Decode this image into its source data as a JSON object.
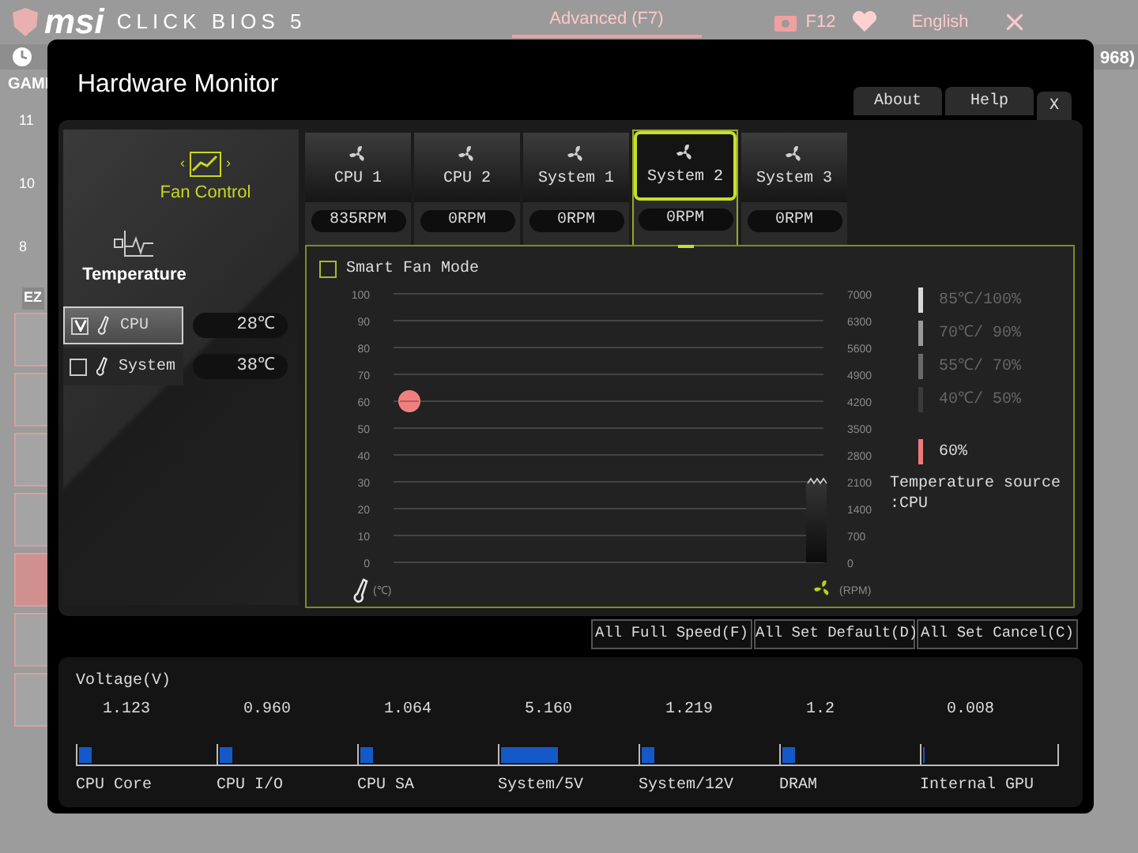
{
  "bios_header": {
    "brand": "msi",
    "product": "CLICK BIOS 5",
    "mode_tab": "Advanced (F7)",
    "screenshot_key": "F12",
    "language": "English"
  },
  "background": {
    "left_label": "GAMI",
    "right_fragment": "968)",
    "side_numbers": [
      "11",
      "10",
      "8"
    ],
    "ez_label": "EZ",
    "sidebar_tabs": [
      {
        "selected": false
      },
      {
        "selected": false
      },
      {
        "selected": false
      },
      {
        "selected": false
      },
      {
        "selected": true
      },
      {
        "selected": false
      },
      {
        "selected": false
      }
    ]
  },
  "dialog": {
    "title": "Hardware Monitor",
    "header_buttons": [
      "About",
      "Help",
      "X"
    ],
    "mode_selector": {
      "label": "Fan Control",
      "prev": "‹",
      "next": "›"
    },
    "temperature_section": {
      "label": "Temperature",
      "sensors": [
        {
          "name": "CPU",
          "reading": "28℃",
          "checked": true,
          "selected": true
        },
        {
          "name": "System",
          "reading": "38℃",
          "checked": false,
          "selected": false
        }
      ]
    },
    "fan_tabs": [
      {
        "label": "CPU 1",
        "rpm": "835RPM",
        "selected": false
      },
      {
        "label": "CPU 2",
        "rpm": "0RPM",
        "selected": false
      },
      {
        "label": "System 1",
        "rpm": "0RPM",
        "selected": false
      },
      {
        "label": "System 2",
        "rpm": "0RPM",
        "selected": true
      },
      {
        "label": "System 3",
        "rpm": "0RPM",
        "selected": false
      }
    ],
    "graph": {
      "smart_fan_mode": {
        "label": "Smart Fan Mode",
        "checked": false
      },
      "temp_ticks": [
        "100",
        "90",
        "80",
        "70",
        "60",
        "50",
        "40",
        "30",
        "20",
        "10",
        "0"
      ],
      "temp_unit": "(℃)",
      "rpm_ticks": [
        "7000",
        "6300",
        "5600",
        "4900",
        "4200",
        "3500",
        "2800",
        "2100",
        "1400",
        "700",
        "0"
      ],
      "rpm_unit": "(RPM)",
      "legend": [
        {
          "text": "85℃/100%",
          "color": "#d8d8d8"
        },
        {
          "text": "70℃/ 90%",
          "color": "#9a9a9a"
        },
        {
          "text": "55℃/ 70%",
          "color": "#6a6a6a"
        },
        {
          "text": "40℃/ 50%",
          "color": "#3a3a3a"
        },
        {
          "text": "60%",
          "color": "#f07a7a"
        }
      ],
      "temperature_source": [
        "Temperature source",
        ":CPU"
      ]
    },
    "action_buttons": [
      "All Full Speed(F)",
      "All Set Default(D)",
      "All Set Cancel(C)"
    ],
    "voltage": {
      "title": "Voltage(V)",
      "items": [
        {
          "name": "CPU Core",
          "value": "1.123",
          "level": 0.09
        },
        {
          "name": "CPU I/O",
          "value": "0.960",
          "level": 0.09
        },
        {
          "name": "CPU SA",
          "value": "1.064",
          "level": 0.09
        },
        {
          "name": "System/5V",
          "value": "5.160",
          "level": 0.41
        },
        {
          "name": "System/12V",
          "value": "1.219",
          "level": 0.09
        },
        {
          "name": "DRAM",
          "value": "1.2",
          "level": 0.09
        },
        {
          "name": "Internal GPU",
          "value": "0.008",
          "level": 0.01
        }
      ]
    }
  }
}
